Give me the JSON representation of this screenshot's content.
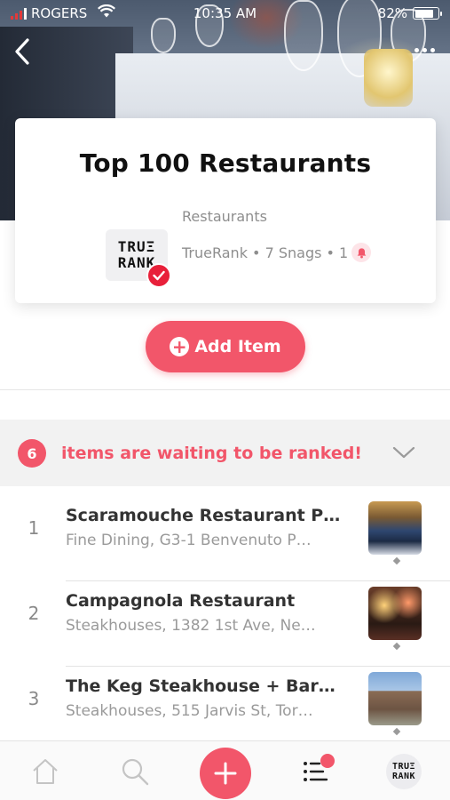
{
  "status_bar": {
    "carrier": "ROGERS",
    "time": "10:35 AM",
    "battery": "82%",
    "battery_level": 0.82
  },
  "header": {
    "back_icon": "chevron-left-icon",
    "more_icon": "ellipsis-icon"
  },
  "list_card": {
    "title": "Top 100 Restaurants",
    "category": "Restaurants",
    "logo_line1": "TRUΞ",
    "logo_line2": "RANK",
    "meta": "TrueRank • 7 Snags • 1",
    "verified_icon": "checkmark-icon",
    "bell_icon": "bell-icon"
  },
  "add_item": {
    "label": "Add Item"
  },
  "waiting_banner": {
    "count": "6",
    "message": "items are waiting to be ranked!"
  },
  "items": [
    {
      "rank": "1",
      "name": "Scaramouche Restaurant P…",
      "subtitle": "Fine Dining, G3-1 Benvenuto P…"
    },
    {
      "rank": "2",
      "name": "Campagnola Restaurant",
      "subtitle": "Steakhouses, 1382 1st Ave, Ne…"
    },
    {
      "rank": "3",
      "name": "The Keg Steakhouse + Bar…",
      "subtitle": "Steakhouses, 515 Jarvis St, Tor…"
    }
  ],
  "tabbar": {
    "home_icon": "home-icon",
    "search_icon": "search-icon",
    "add_icon": "plus-icon",
    "lists_icon": "list-icon",
    "profile_line1": "TRUΞ",
    "profile_line2": "RANK"
  },
  "colors": {
    "accent": "#f2566a",
    "verify": "#e8203a"
  }
}
